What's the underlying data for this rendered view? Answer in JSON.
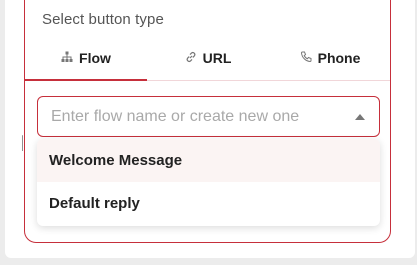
{
  "popover": {
    "heading": "Select button type",
    "tabs": [
      {
        "label": "Flow",
        "icon": "sitemap-icon",
        "active": true
      },
      {
        "label": "URL",
        "icon": "link-icon",
        "active": false
      },
      {
        "label": "Phone",
        "icon": "phone-icon",
        "active": false
      }
    ],
    "flow_select": {
      "placeholder": "Enter flow name or create new one",
      "value": ""
    },
    "options": [
      {
        "label": "Welcome Message",
        "highlighted": true
      },
      {
        "label": "Default reply",
        "highlighted": false
      }
    ]
  },
  "colors": {
    "accent": "#c62f3b",
    "highlight_row": "#fbf4f3",
    "placeholder": "#a9a9a9"
  }
}
